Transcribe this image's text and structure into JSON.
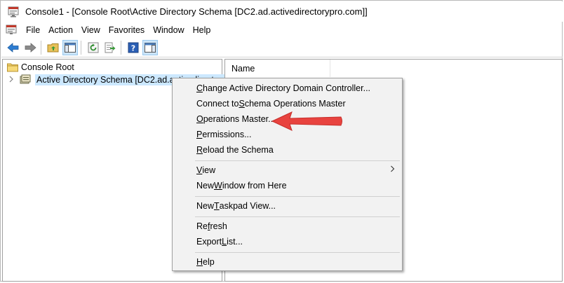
{
  "window": {
    "title": "Console1 - [Console Root\\Active Directory Schema [DC2.ad.activedirectorypro.com]]"
  },
  "menubar": {
    "items": [
      "File",
      "Action",
      "View",
      "Favorites",
      "Window",
      "Help"
    ]
  },
  "toolbar": {
    "icons": [
      "back-arrow-icon",
      "forward-arrow-icon",
      "up-folder-icon",
      "show-hide-tree-icon",
      "refresh-icon",
      "export-list-icon",
      "help-icon",
      "show-hide-action-pane-icon"
    ]
  },
  "tree": {
    "root": "Console Root",
    "child": "Active Directory Schema [DC2.ad.activedirectorypro"
  },
  "list": {
    "column_name": "Name"
  },
  "context_menu": {
    "items": [
      {
        "pre": "",
        "acc": "C",
        "post": "hange Active Directory Domain Controller..."
      },
      {
        "pre": "Connect to ",
        "acc": "S",
        "post": "chema Operations Master"
      },
      {
        "pre": "",
        "acc": "O",
        "post": "perations Master..."
      },
      {
        "pre": "",
        "acc": "P",
        "post": "ermissions..."
      },
      {
        "pre": "",
        "acc": "R",
        "post": "eload the Schema"
      },
      {
        "pre": "",
        "acc": "V",
        "post": "iew"
      },
      {
        "pre": "New ",
        "acc": "W",
        "post": "indow from Here"
      },
      {
        "pre": "New ",
        "acc": "T",
        "post": "askpad View..."
      },
      {
        "pre": "Re",
        "acc": "f",
        "post": "resh"
      },
      {
        "pre": "Export ",
        "acc": "L",
        "post": "ist..."
      },
      {
        "pre": "",
        "acc": "H",
        "post": "elp"
      }
    ]
  },
  "colors": {
    "selection": "#cce8ff",
    "menu_bg": "#f2f2f2",
    "annotation_arrow": "#e8433f"
  }
}
